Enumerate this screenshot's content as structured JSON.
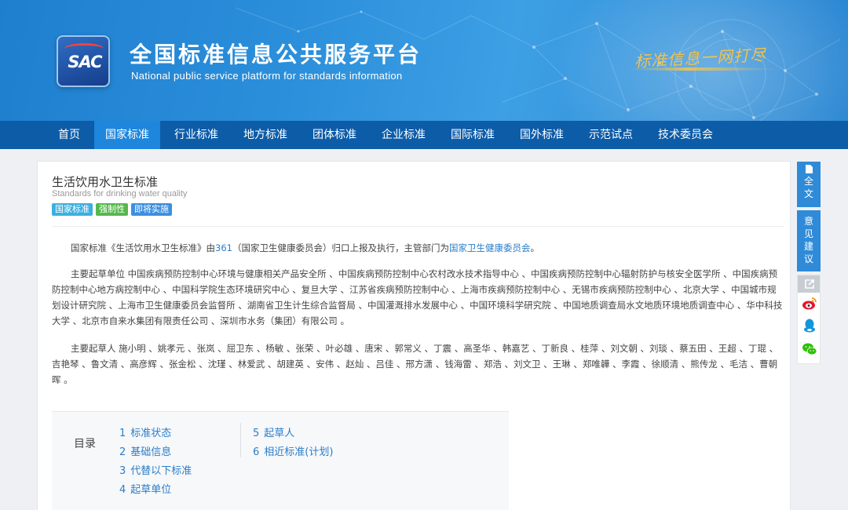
{
  "header": {
    "logo_text": "SAC",
    "title_cn": "全国标准信息公共服务平台",
    "title_en": "National public service platform  for standards information",
    "slogan": "标准信息一网打尽"
  },
  "nav": {
    "items": [
      {
        "label": "首页",
        "active": false
      },
      {
        "label": "国家标准",
        "active": true
      },
      {
        "label": "行业标准",
        "active": false
      },
      {
        "label": "地方标准",
        "active": false
      },
      {
        "label": "团体标准",
        "active": false
      },
      {
        "label": "企业标准",
        "active": false
      },
      {
        "label": "国际标准",
        "active": false
      },
      {
        "label": "国外标准",
        "active": false
      },
      {
        "label": "示范试点",
        "active": false
      },
      {
        "label": "技术委员会",
        "active": false
      }
    ]
  },
  "standard": {
    "title": "生活饮用水卫生标准",
    "title_en": "Standards for drinking water quality",
    "badges": [
      {
        "label": "国家标准",
        "color": "#3bb0e0"
      },
      {
        "label": "强制性",
        "color": "#55b84a"
      },
      {
        "label": "即将实施",
        "color": "#3d8fe0"
      }
    ]
  },
  "body": {
    "p1_prefix": "国家标准《生活饮用水卫生标准》由",
    "p1_code": "361",
    "p1_mid": "（国家卫生健康委员会）归口上报及执行，主管部门为",
    "p1_dept": "国家卫生健康委员会",
    "p1_suffix": "。",
    "p2": "主要起草单位 中国疾病预防控制中心环境与健康相关产品安全所 、中国疾病预防控制中心农村改水技术指导中心 、中国疾病预防控制中心辐射防护与核安全医学所 、中国疾病预防控制中心地方病控制中心 、中国科学院生态环境研究中心 、复旦大学 、江苏省疾病预防控制中心 、上海市疾病预防控制中心 、无锡市疾病预防控制中心 、北京大学 、中国城市规划设计研究院 、上海市卫生健康委员会监督所 、湖南省卫生计生综合监督局 、中国灌溉排水发展中心 、中国环境科学研究院 、中国地质调查局水文地质环境地质调查中心 、华中科技大学 、北京市自来水集团有限责任公司 、深圳市水务（集团）有限公司 。",
    "p3": "主要起草人 施小明 、姚孝元 、张岚 、屈卫东 、杨敏 、张荣 、叶必雄 、唐宋 、郭常义 、丁震 、高圣华 、韩嘉艺 、丁新良 、桂萍 、刘文朝 、刘琰 、蔡五田 、王超 、丁琨 、吉艳琴 、鲁文清 、高彦辉 、张金松 、沈瑾 、林爱武 、胡建英 、安伟 、赵灿 、吕佳 、邢方潇 、钱海雷 、郑浩 、刘文卫 、王琳 、郑唯韡 、李霞 、徐顺清 、熊传龙 、毛洁 、曹朝晖 。"
  },
  "toc": {
    "label": "目录",
    "items": [
      {
        "num": "1",
        "label": "标准状态"
      },
      {
        "num": "2",
        "label": "基础信息"
      },
      {
        "num": "3",
        "label": "代替以下标准"
      },
      {
        "num": "4",
        "label": "起草单位"
      },
      {
        "num": "5",
        "label": "起草人"
      },
      {
        "num": "6",
        "label": "相近标准(计划)"
      }
    ]
  },
  "side": {
    "full_text": "全\n文",
    "feedback": "意\n见\n建\n议"
  }
}
